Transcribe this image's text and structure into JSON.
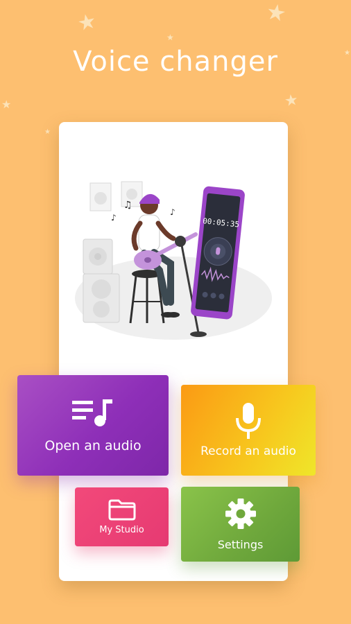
{
  "app": {
    "title": "Voice changer"
  },
  "colors": {
    "background": "#FDBF70",
    "card": "#FFFFFF",
    "open_audio": "#8E2FB8",
    "record_audio": "#F7C81E",
    "my_studio": "#E63A72",
    "settings": "#6FA83C",
    "accent_purple": "#9B45C8"
  },
  "buttons": {
    "open_audio": {
      "label": "Open an audio",
      "icon": "music-list-icon"
    },
    "record_audio": {
      "label": "Record an audio",
      "icon": "microphone-icon"
    },
    "my_studio": {
      "label": "My Studio",
      "icon": "folder-icon"
    },
    "settings": {
      "label": "Settings",
      "icon": "gear-icon"
    }
  },
  "illustration": {
    "phone_timer": "00:05:35"
  }
}
